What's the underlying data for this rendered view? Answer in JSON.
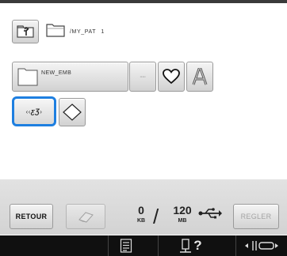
{
  "path": {
    "current_folder": "/MY_PAT1"
  },
  "pattern_row": {
    "new_folder_label": "NEW_EMB",
    "stitch_label": "∙∙∙∙∙",
    "icons": [
      "folder-up-icon",
      "folder-icon",
      "heart-icon",
      "font-letter-icon",
      "diamond-frame-icon"
    ]
  },
  "selected_pattern": {
    "glyph_left": "‹‹",
    "glyph_mid": "ƹƷ",
    "glyph_right": "›"
  },
  "bottom_bar": {
    "back_label": "RETOUR",
    "set_label": "REGLER",
    "memory_used": "0",
    "memory_used_unit": "KB",
    "memory_total": "120",
    "memory_total_unit": "MB",
    "separator": "/"
  },
  "status_bar": {
    "help_label": "?"
  },
  "colors": {
    "selection_border": "#1e7fe0",
    "status_bar_bg": "#101010",
    "disabled_text": "#a5a5a5"
  }
}
